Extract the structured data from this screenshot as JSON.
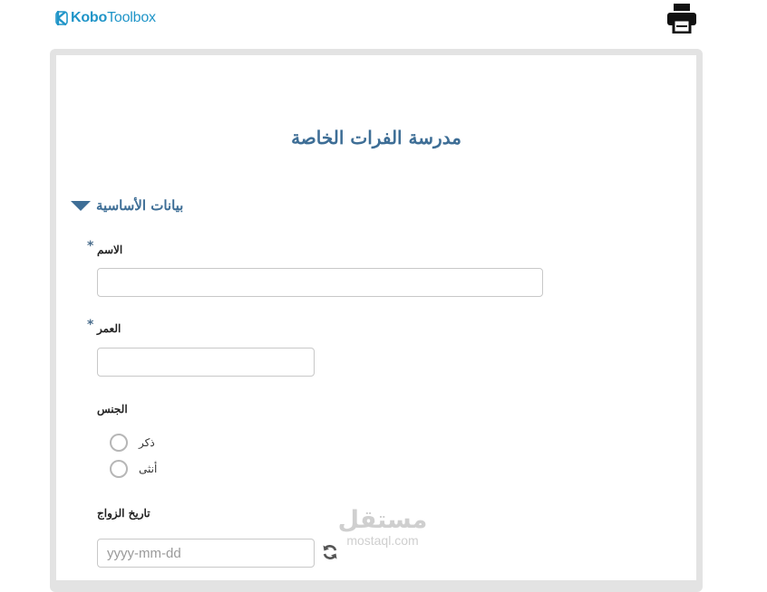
{
  "header": {
    "logo_bold": "Kobo",
    "logo_light": "Toolbox",
    "print_icon": "printer-icon"
  },
  "form": {
    "title": "مدرسة الفرات الخاصة",
    "group": {
      "label": "بيانات الأساسية",
      "icon": "caret-down-icon"
    },
    "required_mark": "*",
    "questions": {
      "name": {
        "label": "الاسم",
        "value": ""
      },
      "age": {
        "label": "العمر",
        "value": ""
      },
      "gender": {
        "label": "الجنس",
        "options": [
          "ذكر",
          "أنثى"
        ]
      },
      "marriage_date": {
        "label": "تاريخ الزواج",
        "placeholder": "yyyy-mm-dd",
        "reset_icon": "refresh-icon"
      }
    }
  },
  "watermark": {
    "arabic": "مستقل",
    "latin": "mostaql.com"
  },
  "colors": {
    "accent": "#3e6e96",
    "logo": "#2095c8",
    "frame": "#e3e3e3"
  }
}
